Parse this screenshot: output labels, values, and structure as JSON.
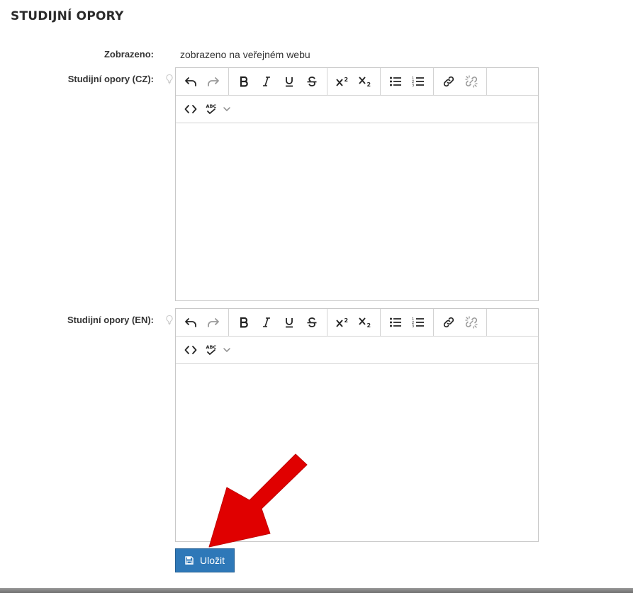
{
  "page": {
    "title": "STUDIJNÍ OPORY"
  },
  "fields": {
    "visibility": {
      "label": "Zobrazeno:",
      "value": "zobrazeno na veřejném webu"
    },
    "editor_cz": {
      "label": "Studijní opory (CZ):",
      "content": ""
    },
    "editor_en": {
      "label": "Studijní opory (EN):",
      "content": ""
    }
  },
  "toolbar": {
    "icons": [
      "undo-icon",
      "redo-icon",
      "bold-icon",
      "italic-icon",
      "underline-icon",
      "strikethrough-icon",
      "superscript-icon",
      "subscript-icon",
      "bullet-list-icon",
      "numbered-list-icon",
      "link-icon",
      "unlink-icon",
      "code-icon",
      "spellcheck-icon",
      "chevron-down-icon"
    ],
    "spellcheck_text": "ABC"
  },
  "actions": {
    "save_label": "Uložit"
  },
  "colors": {
    "primary": "#2e78b8",
    "annotation_arrow": "#e00000"
  }
}
